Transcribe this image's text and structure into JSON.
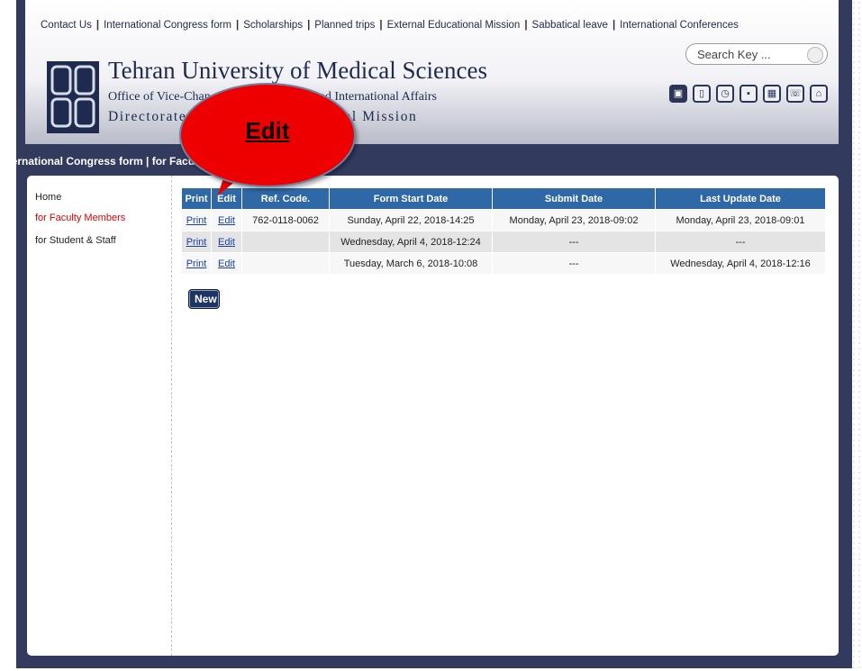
{
  "topnav": {
    "items": [
      "Contact Us",
      "International Congress form",
      "Scholarships",
      "Planned trips",
      "External Educational Mission",
      "Sabbatical leave",
      "International Conferences"
    ]
  },
  "search": {
    "placeholder": "Search Key ..."
  },
  "header": {
    "title": "Tehran University of Medical Sciences",
    "subtitle1": "Office of Vice-Chancellor for Strategies and International Affairs",
    "subtitle2": "Directorate of External Educational Mission"
  },
  "header_icons": [
    "logo-icon",
    "phone-icon",
    "clock-icon",
    "person-icon",
    "sitemap-icon",
    "telephone-icon",
    "home-icon"
  ],
  "breadcrumb": "International Congress form | for Faculty Members",
  "sidebar": {
    "items": [
      {
        "label": "Home",
        "active": false
      },
      {
        "label": "for Faculty Members",
        "active": true
      },
      {
        "label": "for Student & Staff",
        "active": false
      }
    ]
  },
  "table": {
    "headers": [
      "Print",
      "Edit",
      "Ref. Code.",
      "Form Start Date",
      "Submit Date",
      "Last Update Date"
    ],
    "rows": [
      {
        "print": "Print",
        "edit": "Edit",
        "ref": "762-0118-0062",
        "start": "Sunday, April 22, 2018-14:25",
        "submit": "Monday, April 23, 2018-09:02",
        "update": "Monday, April 23, 2018-09:01"
      },
      {
        "print": "Print",
        "edit": "Edit",
        "ref": "",
        "start": "Wednesday, April 4, 2018-12:24",
        "submit": "---",
        "update": "---"
      },
      {
        "print": "Print",
        "edit": "Edit",
        "ref": "",
        "start": "Tuesday, March 6, 2018-10:08",
        "submit": "---",
        "update": "Wednesday, April 4, 2018-12:16"
      }
    ]
  },
  "new_button": "New",
  "callout": {
    "text": "Edit",
    "color": "#ee0000"
  },
  "colors": {
    "frame": "#323a5e",
    "table_header": "#2e68a6",
    "active_link": "#e00000"
  }
}
